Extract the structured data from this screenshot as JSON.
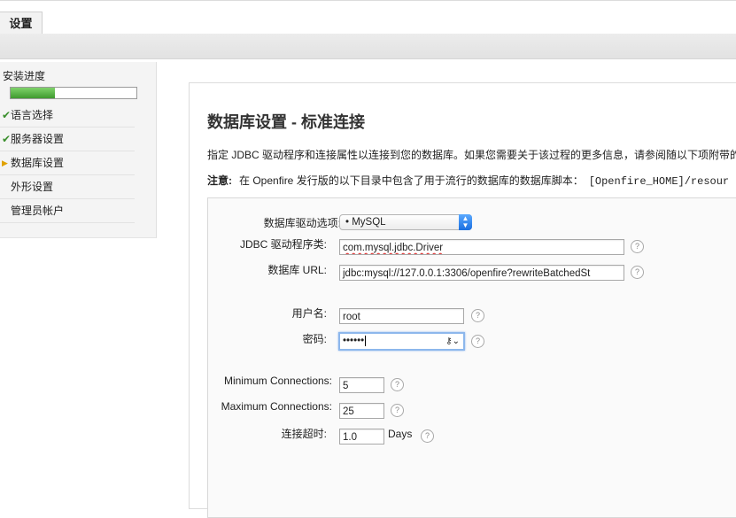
{
  "topbar": {
    "tab_label": "设置"
  },
  "sidebar": {
    "title": "安装进度",
    "progress_fraction": 0.35,
    "items": [
      {
        "mark": "check",
        "label": "语言选择"
      },
      {
        "mark": "check",
        "label": "服务器设置"
      },
      {
        "mark": "arrow",
        "label": "数据库设置"
      },
      {
        "mark": "none",
        "label": "外形设置"
      },
      {
        "mark": "none",
        "label": "管理员帐户"
      }
    ]
  },
  "main": {
    "heading": "数据库设置 - 标准连接",
    "intro": "指定 JDBC 驱动程序和连接属性以连接到您的数据库。如果您需要关于该过程的更多信息，请参阅随以下项附带的",
    "note_label": "注意:",
    "note_text": "在 Openfire 发行版的以下目录中包含了用于流行的数据库的数据库脚本：",
    "note_code": "[Openfire_HOME]/resour"
  },
  "form": {
    "driver_label": "数据库驱动选项:",
    "driver_value": "• MySQL",
    "jdbc_label": "JDBC 驱动程序类:",
    "jdbc_value": "com.mysql.jdbc.Driver",
    "url_label": "数据库 URL:",
    "url_value": "jdbc:mysql://127.0.0.1:3306/openfire?rewriteBatchedSt",
    "username_label": "用户名:",
    "username_value": "root",
    "password_label": "密码:",
    "password_value": "••••••",
    "min_conn_label": "Minimum Connections:",
    "min_conn_value": "5",
    "max_conn_label": "Maximum Connections:",
    "max_conn_value": "25",
    "timeout_label": "连接超时:",
    "timeout_value": "1.0",
    "timeout_unit": "Days",
    "help_glyph": "?"
  }
}
